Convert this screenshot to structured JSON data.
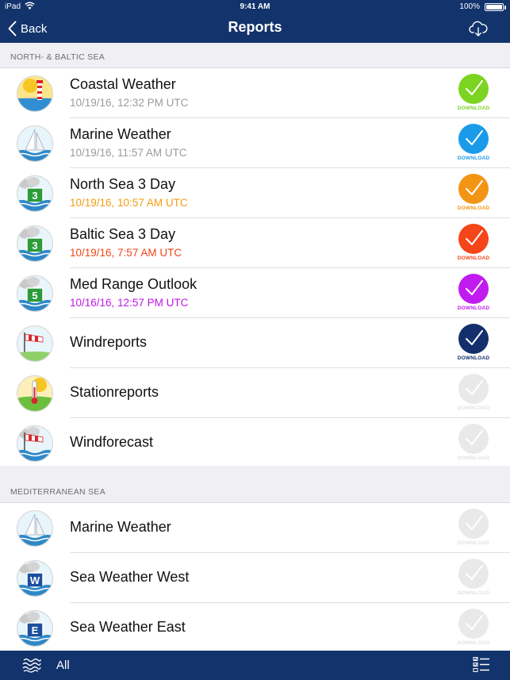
{
  "status_bar": {
    "carrier": "iPad",
    "time": "9:41 AM",
    "battery": "100%",
    "battery_level": 1.0
  },
  "nav": {
    "back_label": "Back",
    "title": "Reports",
    "action_icon": "cloud-download-icon"
  },
  "sections": [
    {
      "title": "NORTH- & BALTIC SEA",
      "rows": [
        {
          "title": "Coastal Weather",
          "subtitle": "10/19/16, 12:32 PM UTC",
          "subtitle_color": "#9b9b9b",
          "icon": "lighthouse",
          "download_label": "DOWNLOAD",
          "download_color": "#7dd321",
          "enabled": true
        },
        {
          "title": "Marine Weather",
          "subtitle": "10/19/16, 11:57 AM UTC",
          "subtitle_color": "#9b9b9b",
          "icon": "sail",
          "download_label": "DOWNLOAD",
          "download_color": "#1a9bea",
          "enabled": true
        },
        {
          "title": "North Sea 3 Day",
          "subtitle": "10/19/16, 10:57 AM UTC",
          "subtitle_color": "#f39c12",
          "icon": "day-3",
          "badge": "3",
          "download_label": "DOWNLOAD",
          "download_color": "#f39514",
          "enabled": true
        },
        {
          "title": "Baltic Sea 3 Day",
          "subtitle": "10/19/16, 7:57 AM UTC",
          "subtitle_color": "#f04517",
          "icon": "day-3",
          "badge": "3",
          "download_label": "DOWNLOAD",
          "download_color": "#f4461a",
          "enabled": true
        },
        {
          "title": "Med Range Outlook",
          "subtitle": "10/16/16, 12:57 PM UTC",
          "subtitle_color": "#c118e6",
          "icon": "day-5",
          "badge": "5",
          "download_label": "DOWNLOAD",
          "download_color": "#c11bf0",
          "enabled": true
        },
        {
          "title": "Windreports",
          "subtitle": "",
          "icon": "windsock",
          "download_label": "DOWNLOAD",
          "download_color": "#142f6c",
          "enabled": true
        },
        {
          "title": "Stationreports",
          "subtitle": "",
          "icon": "thermometer",
          "download_label": "DOWNLOAD",
          "download_color": "#e9e9e9",
          "enabled": false
        },
        {
          "title": "Windforecast",
          "subtitle": "",
          "icon": "windsock-cloud",
          "download_label": "DOWNLOAD",
          "download_color": "#e9e9e9",
          "enabled": false
        }
      ]
    },
    {
      "title": "MEDITERRANEAN SEA",
      "rows": [
        {
          "title": "Marine Weather",
          "subtitle": "",
          "icon": "sail",
          "download_label": "DOWNLOAD",
          "download_color": "#e9e9e9",
          "enabled": false
        },
        {
          "title": "Sea Weather West",
          "subtitle": "",
          "icon": "letter-w",
          "badge": "W",
          "download_label": "DOWNLOAD",
          "download_color": "#e9e9e9",
          "enabled": false
        },
        {
          "title": "Sea Weather East",
          "subtitle": "",
          "icon": "letter-e",
          "badge": "E",
          "download_label": "DOWNLOAD",
          "download_color": "#e9e9e9",
          "enabled": false
        }
      ]
    }
  ],
  "toolbar": {
    "filter_label": "All",
    "left_icon": "waves-icon",
    "right_icon": "checklist-icon"
  },
  "colors": {
    "nav_bg": "#12336b",
    "section_bg": "#efeff4",
    "disabled": "#e9e9e9"
  }
}
